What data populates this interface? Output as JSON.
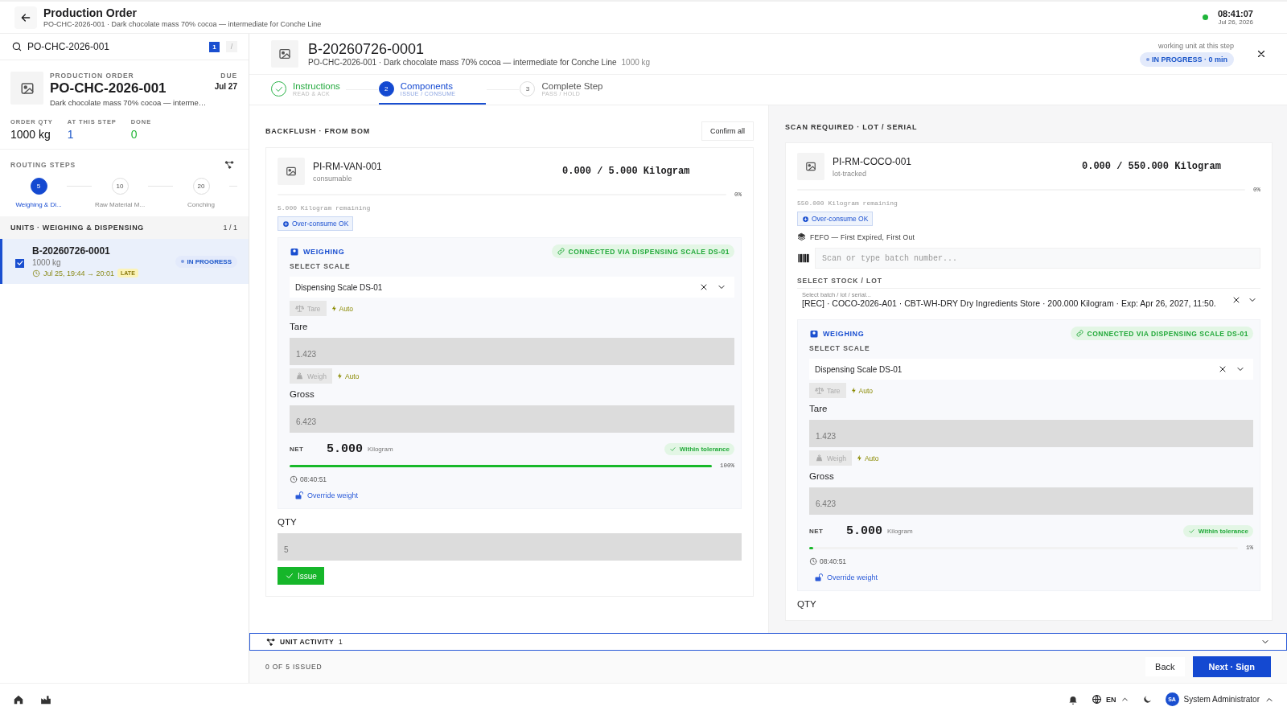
{
  "header": {
    "title": "Production Order",
    "subtitle": "PO-CHC-2026-001 · Dark chocolate mass 70% cocoa — intermediate for Conche Line",
    "online": true,
    "time": "08:41:07",
    "date": "Jul 26, 2026"
  },
  "sidebar": {
    "search": {
      "value": "PO-CHC-2026-001",
      "count": "1",
      "shortcut": "/"
    },
    "order": {
      "label": "PRODUCTION ORDER",
      "number": "PO-CHC-2026-001",
      "description": "Dark chocolate mass 70% cocoa — interme…",
      "due_label": "DUE",
      "due": "Jul 27"
    },
    "stats": [
      {
        "label": "ORDER QTY",
        "value": "1000 kg",
        "kind": "plain"
      },
      {
        "label": "AT THIS STEP",
        "value": "1",
        "kind": "info"
      },
      {
        "label": "DONE",
        "value": "0",
        "kind": "success"
      }
    ],
    "routing": {
      "title": "ROUTING STEPS",
      "steps": [
        {
          "number": "5",
          "label": "Weighing & Di...",
          "selected": true
        },
        {
          "number": "10",
          "label": "Raw Material M...",
          "selected": false
        },
        {
          "number": "20",
          "label": "Conching",
          "selected": false
        }
      ]
    },
    "units": {
      "title": "UNITS · WEIGHING & DISPENSING",
      "count": "1 / 1",
      "items": [
        {
          "id": "B-20260726-0001",
          "qty": "1000 kg",
          "window": "Jul 25, 19:44 → 20:01",
          "late": "LATE",
          "status": "IN PROGRESS",
          "checked": true,
          "selected": true
        }
      ]
    }
  },
  "unit": {
    "id": "B-20260726-0001",
    "subtitle": "PO-CHC-2026-001 · Dark chocolate mass 70% cocoa — intermediate for Conche Line",
    "qty": "1000 kg",
    "working_label": "working unit at this step",
    "status": "IN PROGRESS · 0 min"
  },
  "stepper": [
    {
      "title": "Instructions",
      "subtitle": "READ & ACK",
      "done": true,
      "selected": false
    },
    {
      "number": "2",
      "title": "Components",
      "subtitle": "ISSUE / CONSUME",
      "done": false,
      "selected": true
    },
    {
      "number": "3",
      "title": "Complete Step",
      "subtitle": "PASS / HOLD",
      "done": false,
      "selected": false
    }
  ],
  "columns": [
    {
      "kind": "backflush",
      "title": "BACKFLUSH · FROM BOM",
      "confirm": "Confirm all",
      "component": {
        "code": "PI-RM-VAN-001",
        "type": "consumable",
        "qty": "0.000 / 5.000 Kilogram",
        "percent": "0%",
        "remaining": "5.000 Kilogram remaining",
        "over_consume": "Over-consume OK"
      },
      "weighing": {
        "title": "WEIGHING",
        "connected": "CONNECTED VIA DISPENSING SCALE DS-01",
        "scale_label": "SELECT SCALE",
        "scale": "Dispensing Scale DS-01",
        "tare_button": "Tare",
        "tare_auto": "Auto",
        "tare_label": "Tare",
        "tare_value": "1.423",
        "weigh_button": "Weigh",
        "weigh_auto": "Auto",
        "gross_label": "Gross",
        "gross_value": "6.423",
        "net_label": "NET",
        "net_value": "5.000",
        "net_unit": "Kilogram",
        "tolerance": "Within tolerance",
        "level": 1,
        "percent": "100%",
        "time": "08:40:51",
        "override": "Override weight"
      },
      "qty_label": "QTY",
      "qty_value": "5",
      "issue": "Issue"
    },
    {
      "kind": "scan",
      "title": "SCAN REQUIRED · LOT / SERIAL",
      "component": {
        "code": "PI-RM-COCO-001",
        "type": "lot-tracked",
        "qty": "0.000 / 550.000 Kilogram",
        "percent": "0%",
        "remaining": "550.000 Kilogram remaining",
        "over_consume": "Over-consume OK"
      },
      "fefo": "FEFO — First Expired, First Out",
      "scan_placeholder": "Scan or type batch number...",
      "stock": {
        "label": "SELECT STOCK / LOT",
        "floating_label": "Select batch / lot / serial...",
        "value": "[REC] · COCO-2026-A01 · CBT-WH-DRY Dry Ingredients Store · 200.000 Kilogram · Exp: Apr 26, 2027, 11:50."
      },
      "weighing": {
        "title": "WEIGHING",
        "connected": "CONNECTED VIA DISPENSING SCALE DS-01",
        "scale_label": "SELECT SCALE",
        "scale": "Dispensing Scale DS-01",
        "tare_button": "Tare",
        "tare_auto": "Auto",
        "tare_label": "Tare",
        "tare_value": "1.423",
        "weigh_button": "Weigh",
        "weigh_auto": "Auto",
        "gross_label": "Gross",
        "gross_value": "6.423",
        "net_label": "NET",
        "net_value": "5.000",
        "net_unit": "Kilogram",
        "tolerance": "Within tolerance",
        "level": 0.01,
        "percent": "1%",
        "time": "08:40:51",
        "override": "Override weight"
      },
      "qty_label": "QTY"
    }
  ],
  "activity": {
    "label": "UNIT ACTIVITY",
    "count": "1"
  },
  "footer": {
    "issued": "0 OF 5 ISSUED",
    "back": "Back",
    "next": "Next · Sign"
  },
  "appbar": {
    "language": "EN",
    "initials": "SA",
    "user": "System Administrator"
  }
}
